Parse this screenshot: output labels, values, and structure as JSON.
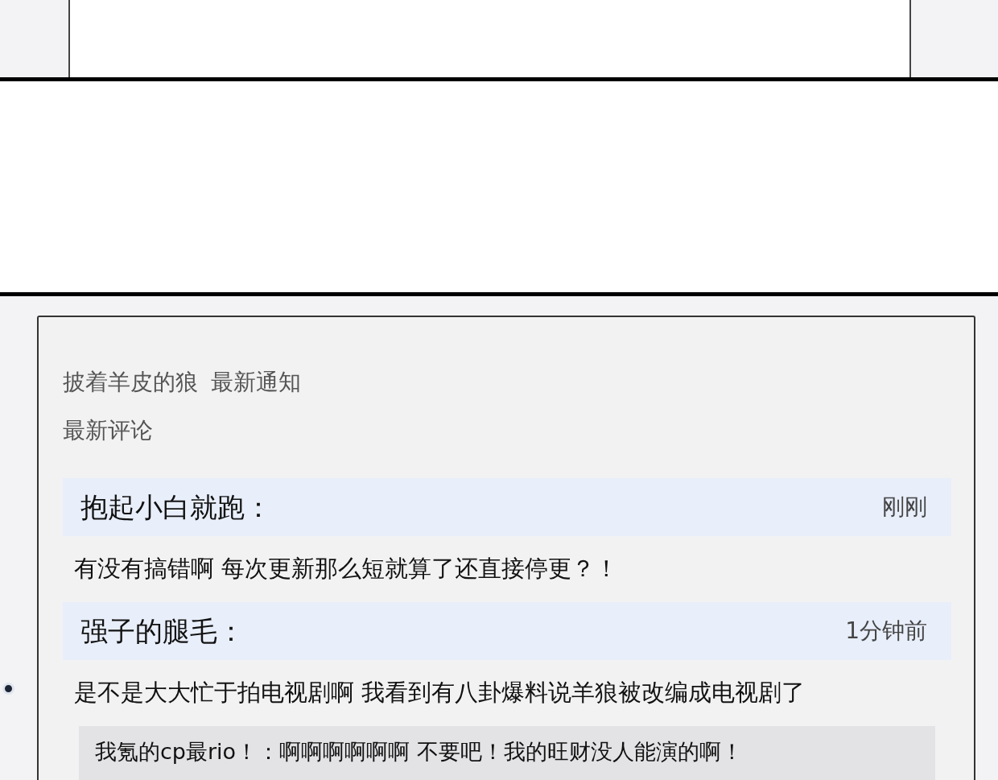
{
  "header": {
    "title": "披着羊皮的狼",
    "link": "最新通知"
  },
  "section_title": "最新评论",
  "comments": [
    {
      "user": "抱起小白就跑：",
      "time": "刚刚",
      "text": "有没有搞错啊 每次更新那么短就算了还直接停更？！"
    },
    {
      "user": "强子的腿毛：",
      "time": "1分钟前",
      "text": "是不是大大忙于拍电视剧啊 我看到有八卦爆料说羊狼被改编成电视剧了",
      "reply": "我氪的cp最rio！：啊啊啊啊啊啊 不要吧！我的旺财没人能演的啊！"
    }
  ]
}
